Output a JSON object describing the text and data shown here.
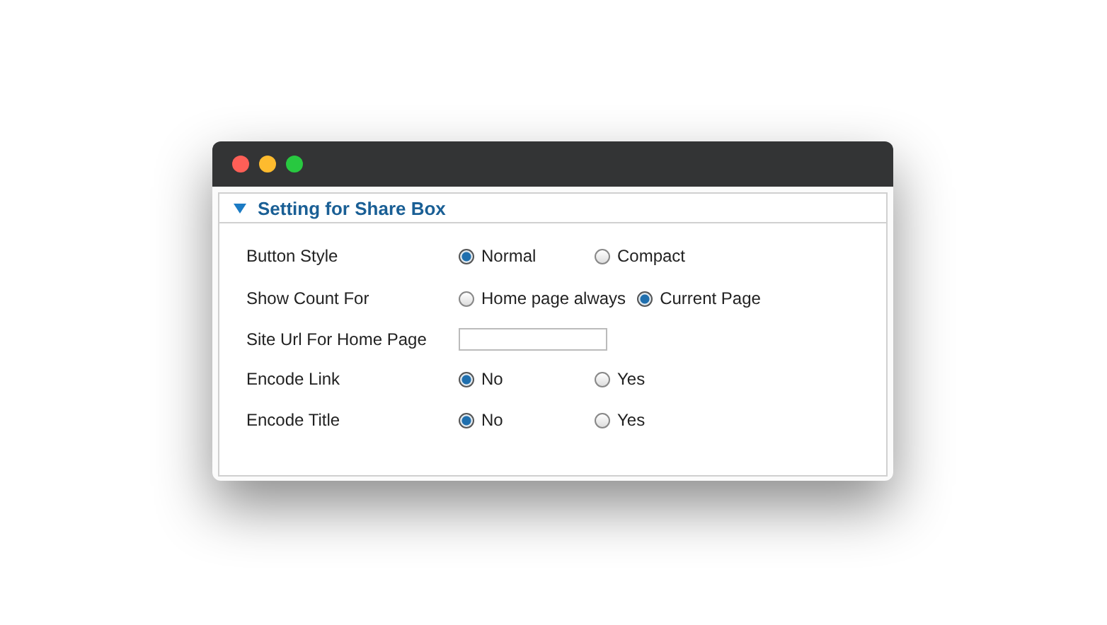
{
  "panel": {
    "title": "Setting for Share Box",
    "expanded": true
  },
  "rows": [
    {
      "kind": "radio",
      "label": "Button Style",
      "options": [
        {
          "label": "Normal",
          "selected": true
        },
        {
          "label": "Compact",
          "selected": false
        }
      ]
    },
    {
      "kind": "radio",
      "label": "Show Count For",
      "options": [
        {
          "label": "Home page always",
          "selected": false
        },
        {
          "label": "Current Page",
          "selected": true
        }
      ]
    },
    {
      "kind": "text",
      "label": "Site Url For Home Page"
    },
    {
      "kind": "radio",
      "label": "Encode Link",
      "options": [
        {
          "label": "No",
          "selected": true
        },
        {
          "label": "Yes",
          "selected": false
        }
      ]
    },
    {
      "kind": "radio",
      "label": "Encode Title",
      "options": [
        {
          "label": "No",
          "selected": true
        },
        {
          "label": "Yes",
          "selected": false
        }
      ]
    }
  ]
}
